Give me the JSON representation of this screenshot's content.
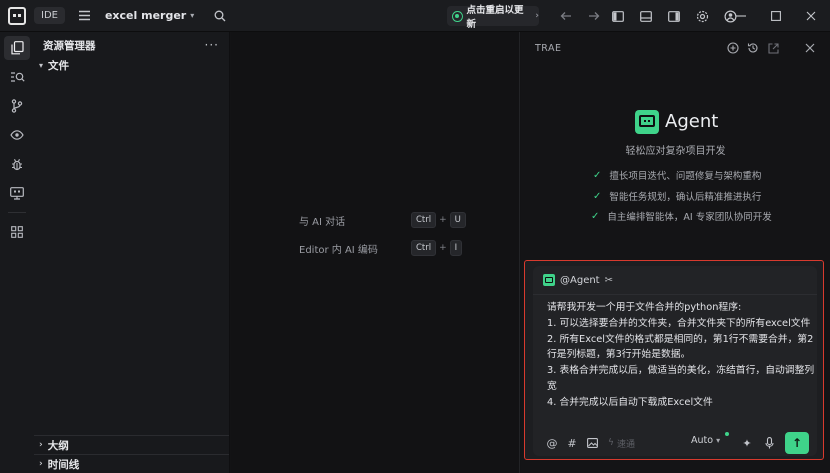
{
  "titlebar": {
    "ide_label": "IDE",
    "project_name": "excel merger",
    "update_label": "点击重启以更新"
  },
  "sidebar": {
    "title": "资源管理器",
    "root_folder": "文件",
    "outline_label": "大纲",
    "timeline_label": "时间线"
  },
  "editor": {
    "hints": [
      {
        "label": "与 AI 对话",
        "keys": [
          "Ctrl",
          "U"
        ]
      },
      {
        "label": "Editor 内 AI 编码",
        "keys": [
          "Ctrl",
          "I"
        ]
      }
    ],
    "plus": "+"
  },
  "panel": {
    "title": "TRAE",
    "agent_name": "Agent",
    "agent_subtitle": "轻松应对复杂项目开发",
    "features": [
      "擅长项目迭代、问题修复与架构重构",
      "智能任务规划，确认后精准推进执行",
      "自主编排智能体，AI 专家团队协同开发"
    ]
  },
  "chat": {
    "mention": "@Agent",
    "prompt_lines": [
      "请帮我开发一个用于文件合并的python程序:",
      "1. 可以选择要合并的文件夹，合并文件夹下的所有excel文件",
      "2. 所有Excel文件的格式都是相同的，第1行不需要合并，第2行是列标题，第3行开始是数据。",
      "3. 表格合并完成以后，做适当的美化，冻结首行，自动调整列宽",
      "4. 合并完成以后自动下载成Excel文件"
    ],
    "speed_label": "速通",
    "model_label": "Auto"
  },
  "colors": {
    "accent": "#3fd38a",
    "highlight_border": "#d83a2e"
  }
}
